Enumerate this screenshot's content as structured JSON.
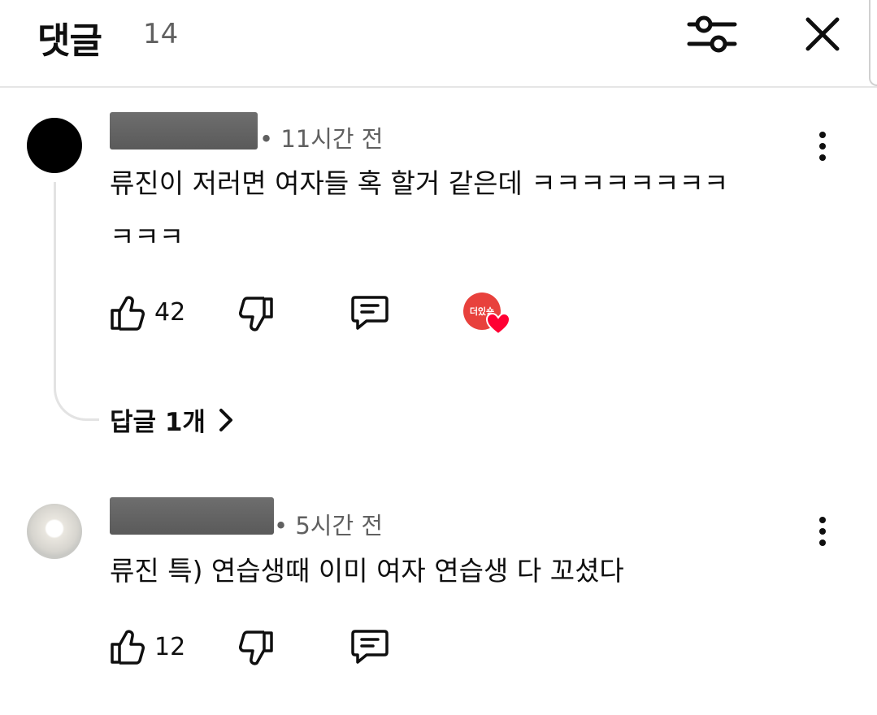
{
  "header": {
    "title": "댓글",
    "count": "14"
  },
  "comments": [
    {
      "time": "• 11시간 전",
      "text_line1": "류진이 저러면 여자들 혹 할거 같은데 ㅋㅋㅋㅋㅋㅋㅋㅋ",
      "text_line2": "ㅋㅋㅋ",
      "likes": "42",
      "replies_label": "답글 1개",
      "creator_badge_text": "더있숑"
    },
    {
      "time": "• 5시간 전",
      "text_line1": "류진 특) 연습생때 이미 여자 연습생 다 꼬셨다",
      "likes": "12"
    }
  ],
  "colors": {
    "creator_badge": "#e8413c",
    "heart": "#ff0033",
    "secondary_text": "#606060"
  },
  "icons": [
    "filter-icon",
    "close-icon",
    "more-vert-icon",
    "thumb-up-icon",
    "thumb-down-icon",
    "reply-icon",
    "chevron-right-icon",
    "heart-icon"
  ]
}
